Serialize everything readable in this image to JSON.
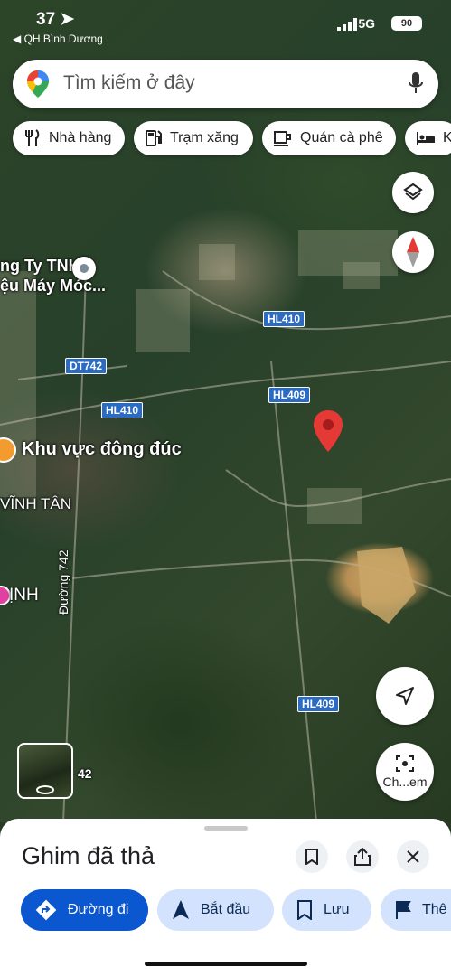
{
  "status_bar": {
    "time": "37",
    "back_label": "◀ QH Bình Dương",
    "network": "5G",
    "battery": "90"
  },
  "search": {
    "placeholder": "Tìm kiếm ở đây"
  },
  "chips": [
    {
      "label": "Nhà hàng",
      "icon": "restaurant-icon"
    },
    {
      "label": "Trạm xăng",
      "icon": "gas-station-icon"
    },
    {
      "label": "Quán cà phê",
      "icon": "coffee-icon"
    },
    {
      "label": "Kh",
      "icon": "hotel-icon"
    }
  ],
  "map": {
    "place_labels": [
      "ng Ty TNHH",
      "ệu Máy Móc...",
      "Khu vực đông đúc",
      "VĨNH TÂN",
      "ỊNH"
    ],
    "road_shields": [
      "HL410",
      "DT742",
      "HL409",
      "HL410",
      "HL409"
    ],
    "road_name": "Đường 742",
    "road_fragment": "42",
    "street_view_label": "Ch...em",
    "colors": {
      "shield": "#2b6bc2",
      "pin": "#e53935"
    }
  },
  "sheet": {
    "title": "Ghim đã thả",
    "actions": [
      {
        "label": "Đường đi",
        "icon": "directions-icon"
      },
      {
        "label": "Bắt đầu",
        "icon": "navigation-arrow-icon"
      },
      {
        "label": "Lưu",
        "icon": "bookmark-icon"
      },
      {
        "label": "Thê",
        "icon": "flag-icon"
      }
    ],
    "colors": {
      "primary": "#0b57d0",
      "tonal": "#d3e3fd"
    }
  }
}
